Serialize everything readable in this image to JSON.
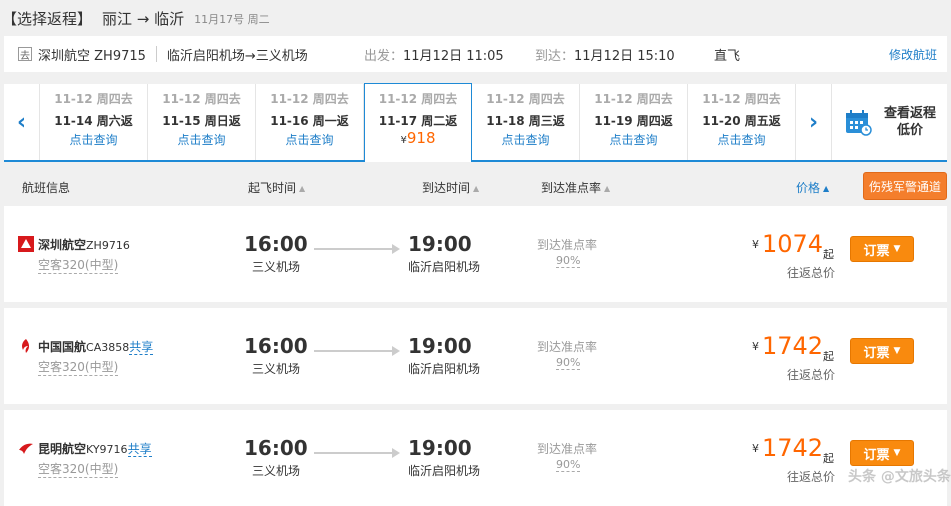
{
  "header": {
    "title": "【选择返程】",
    "route": "丽江 → 临沂",
    "date": "11月17号 周二"
  },
  "outbound": {
    "badge": "去",
    "flight": "深圳航空 ZH9715",
    "route": "临沂启阳机场→三义机场",
    "dep_label": "出发：",
    "dep_value": "11月12日 11:05",
    "arr_label": "到达：",
    "arr_value": "11月12日 15:10",
    "type": "直飞",
    "modify": "修改航班"
  },
  "date_strip": {
    "cells": [
      {
        "go": "11-12 周四去",
        "ret": "11-14 周六返",
        "action": "点击查询"
      },
      {
        "go": "11-12 周四去",
        "ret": "11-15 周日返",
        "action": "点击查询"
      },
      {
        "go": "11-12 周四去",
        "ret": "11-16 周一返",
        "action": "点击查询"
      },
      {
        "go": "11-12 周四去",
        "ret": "11-17 周二返",
        "currency": "¥",
        "price": "918",
        "selected": true
      },
      {
        "go": "11-12 周四去",
        "ret": "11-18 周三返",
        "action": "点击查询"
      },
      {
        "go": "11-12 周四去",
        "ret": "11-19 周四返",
        "action": "点击查询"
      },
      {
        "go": "11-12 周四去",
        "ret": "11-20 周五返",
        "action": "点击查询"
      }
    ],
    "return_label_1": "查看返程",
    "return_label_2": "低价"
  },
  "columns": {
    "flight_info": "航班信息",
    "dep_time": "起飞时间",
    "arr_time": "到达时间",
    "on_time": "到达准点率",
    "price": "价格",
    "warning": "伤残军警通道"
  },
  "flights": [
    {
      "airline": "深圳航空",
      "flight_no": "ZH9716",
      "share": "",
      "plane": "空客320(中型)",
      "dep_time": "16:00",
      "dep_airport": "三义机场",
      "arr_time": "19:00",
      "arr_airport": "临沂启阳机场",
      "ontime_label": "到达准点率",
      "ontime_value": "90%",
      "currency": "¥",
      "price": "1074",
      "qi": "起",
      "total": "往返总价",
      "book": "订票",
      "logo_color": "#d7191c"
    },
    {
      "airline": "中国国航",
      "flight_no": "CA3858",
      "share": "共享",
      "plane": "空客320(中型)",
      "dep_time": "16:00",
      "dep_airport": "三义机场",
      "arr_time": "19:00",
      "arr_airport": "临沂启阳机场",
      "ontime_label": "到达准点率",
      "ontime_value": "90%",
      "currency": "¥",
      "price": "1742",
      "qi": "起",
      "total": "往返总价",
      "book": "订票",
      "logo_color": "#d7191c"
    },
    {
      "airline": "昆明航空",
      "flight_no": "KY9716",
      "share": "共享",
      "plane": "空客320(中型)",
      "dep_time": "16:00",
      "dep_airport": "三义机场",
      "arr_time": "19:00",
      "arr_airport": "临沂启阳机场",
      "ontime_label": "到达准点率",
      "ontime_value": "90%",
      "currency": "¥",
      "price": "1742",
      "qi": "起",
      "total": "往返总价",
      "book": "订票",
      "logo_color": "#d7191c"
    }
  ],
  "watermark": "头条 @文旅头条"
}
